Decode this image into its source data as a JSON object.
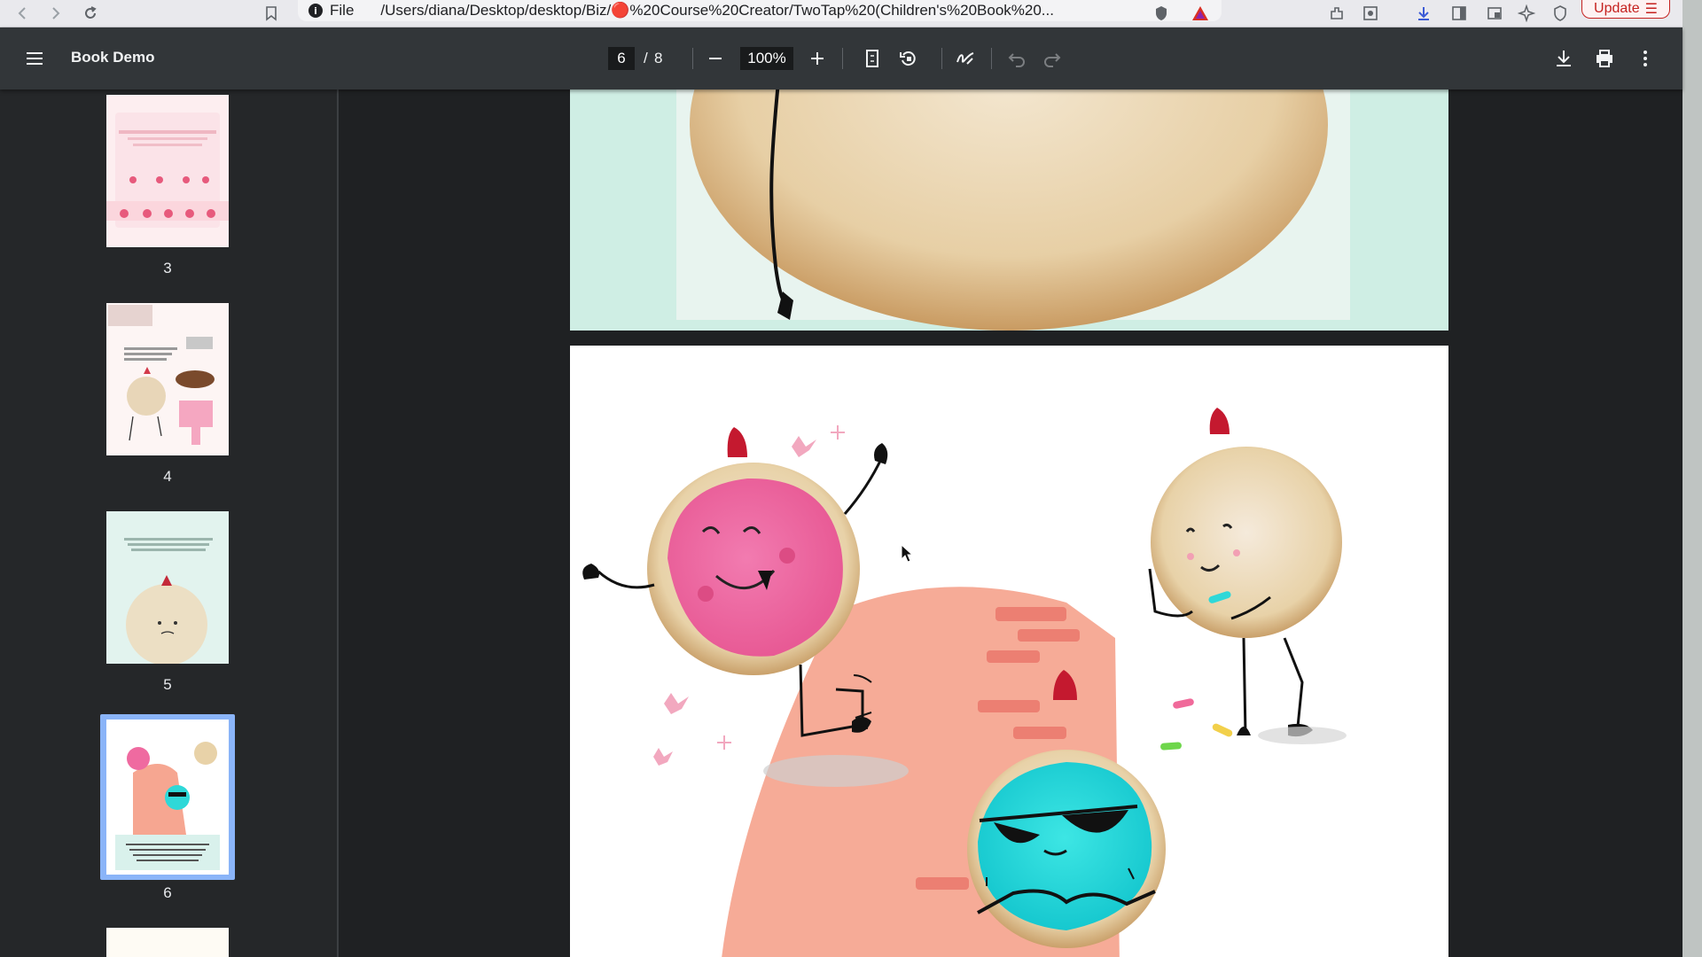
{
  "browser": {
    "url_scheme": "File",
    "url": "/Users/diana/Desktop/desktop/Biz/🔴%20Course%20Creator/TwoTap%20(Children's%20Book%20...",
    "update_label": "Update",
    "icons": [
      "back-icon",
      "forward-icon",
      "reload-icon",
      "bookmark-icon",
      "info-icon",
      "shield-icon",
      "warning-icon",
      "extensions-icon",
      "screenshot-icon",
      "download-icon",
      "sidebar-icon",
      "tab-icon",
      "ai-icon",
      "vpn-icon",
      "menu-icon"
    ]
  },
  "toolbar": {
    "title": "Book Demo",
    "page_current": "6",
    "page_separator": "/",
    "page_total": "8",
    "zoom": "100%",
    "icons": [
      "menu-icon",
      "zoom-out-icon",
      "zoom-in-icon",
      "fit-page-icon",
      "rotate-icon",
      "draw-icon",
      "undo-icon",
      "redo-icon",
      "download-icon",
      "print-icon",
      "more-icon"
    ]
  },
  "sidebar": {
    "thumbnails": [
      {
        "label": "3"
      },
      {
        "label": "4"
      },
      {
        "label": "5"
      },
      {
        "label": "6",
        "selected": true
      }
    ]
  },
  "colors": {
    "toolbar_bg": "#323639",
    "sidebar_bg": "#252729",
    "viewer_bg": "#1f2123",
    "selection": "#8ab4f8",
    "jam_pink": "#ef6aa0",
    "icing_cyan": "#2fd8d8",
    "cookie_tan": "#e4c79c",
    "brick": "#f0967e"
  }
}
